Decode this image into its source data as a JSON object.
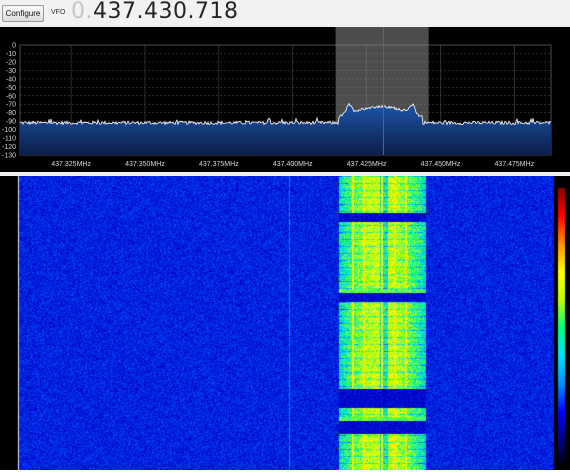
{
  "toolbar": {
    "configure_label": "Configure",
    "vfo_label": "VFO",
    "vfo_frequency_dim": "0.",
    "vfo_frequency": "437.430.718"
  },
  "spectrum": {
    "background_color": "#000000",
    "grid_color": "#3c3c3c",
    "fill_color": "#1c56a8",
    "trace_color": "#ffffff",
    "passband_color": "#8c8c8c",
    "center_line_color": "#ff2020",
    "y_ticks": [
      "0",
      "-10",
      "-20",
      "-30",
      "-40",
      "-50",
      "-60",
      "-70",
      "-80",
      "-90",
      "-100",
      "-110",
      "-120",
      "-130"
    ],
    "y_range_db": [
      -130,
      0
    ],
    "x_ticks": [
      "437.325MHz",
      "437.350MHz",
      "437.375MHz",
      "437.400MHz",
      "437.425MHz",
      "437.450MHz",
      "437.475MHz"
    ],
    "x_tick_values_mhz": [
      437.325,
      437.35,
      437.375,
      437.4,
      437.425,
      437.45,
      437.475
    ],
    "x_range_mhz": [
      437.3077,
      437.4874
    ],
    "passband_mhz": [
      437.4145,
      437.446
    ],
    "center_mhz": 437.4307,
    "noise_floor_db": -92,
    "signal_peak_db": -62
  },
  "waterfall": {
    "background_color": "#0d1f5c",
    "colormap": [
      "#000080",
      "#0000ff",
      "#00c8ff",
      "#00ff80",
      "#ffff00",
      "#ff8000",
      "#ff0000"
    ],
    "colorbar": [
      "#000000",
      "#000080",
      "#0000ff",
      "#0090ff",
      "#00e0ff",
      "#00ff80",
      "#c0ff00",
      "#ffff00",
      "#ff9000",
      "#ff0000",
      "#8b0000"
    ]
  }
}
